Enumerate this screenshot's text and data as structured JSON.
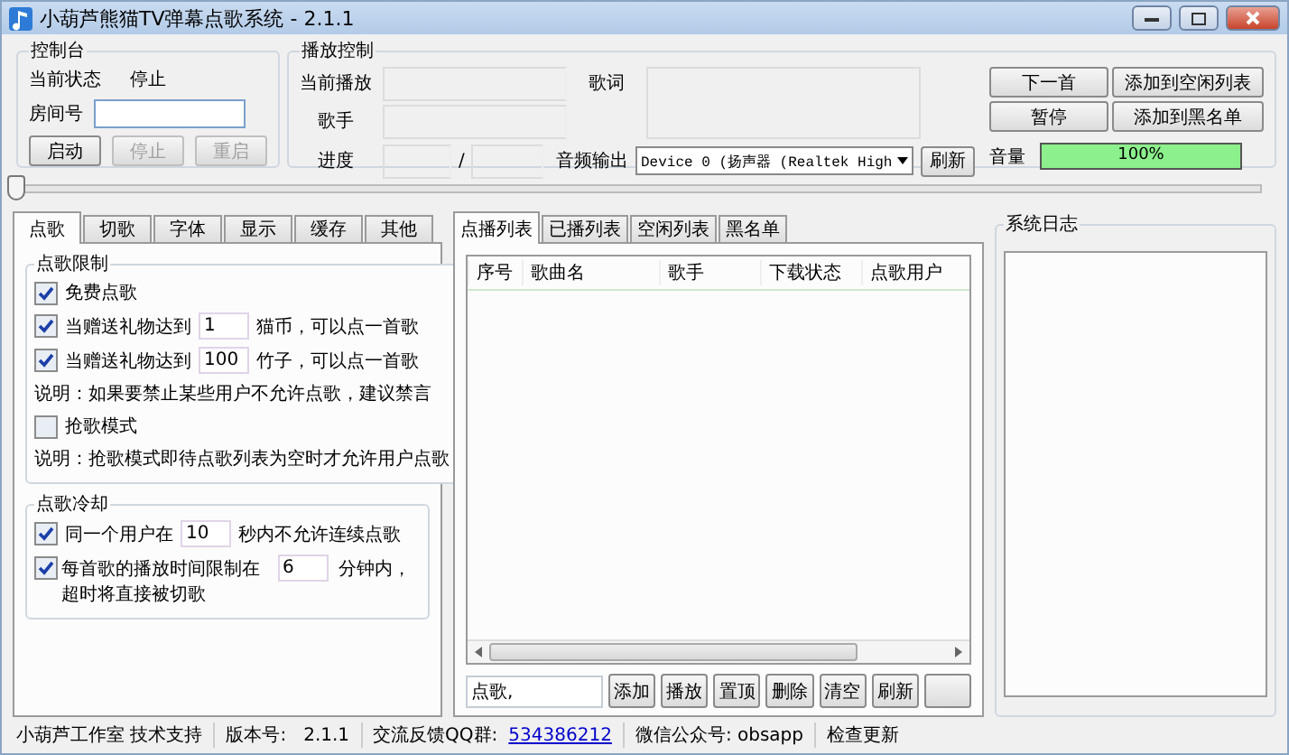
{
  "window": {
    "title": "小葫芦熊猫TV弹幕点歌系统 - 2.1.1"
  },
  "console": {
    "title": "控制台",
    "status_label": "当前状态",
    "status_value": "停止",
    "room_label": "房间号",
    "buttons": [
      {
        "label": "启动",
        "disabled": false
      },
      {
        "label": "停止",
        "disabled": true
      },
      {
        "label": "重启",
        "disabled": true
      }
    ]
  },
  "playback": {
    "title": "播放控制",
    "now_label": "当前播放",
    "singer_label": "歌手",
    "progress_label": "进度",
    "separator": "/",
    "lyrics_label": "歌词",
    "audio_label": "音频输出",
    "audio_device": "Device 0 (扬声器 (Realtek High",
    "refresh": "刷新",
    "buttons": [
      "下一首",
      "添加到空闲列表",
      "暂停",
      "添加到黑名单"
    ],
    "volume_label": "音量",
    "volume": {
      "level": 1,
      "reading": "100%"
    }
  },
  "seek": {
    "level": 0
  },
  "settings_tabs": [
    {
      "label": "点歌",
      "selected": true
    },
    {
      "label": "切歌",
      "selected": false
    },
    {
      "label": "字体",
      "selected": false
    },
    {
      "label": "显示",
      "selected": false
    },
    {
      "label": "缓存",
      "selected": false
    },
    {
      "label": "其他",
      "selected": false
    }
  ],
  "groups": [
    {
      "title": "点歌限制",
      "items": [
        {
          "kind": "check",
          "label": "免费点歌",
          "checked": true
        },
        {
          "kind": "field",
          "label": "当赠送礼物达到",
          "checked": true,
          "value": "1",
          "suffix": "猫币，可以点一首歌"
        },
        {
          "kind": "field",
          "label": "当赠送礼物达到",
          "checked": true,
          "value": "100",
          "suffix": "竹子，可以点一首歌"
        },
        {
          "kind": "note",
          "text": "说明：如果要禁止某些用户不允许点歌，建议禁言"
        },
        {
          "kind": "check",
          "label": "抢歌模式",
          "checked": false
        },
        {
          "kind": "note",
          "text": "说明：抢歌模式即待点歌列表为空时才允许用户点歌"
        }
      ]
    },
    {
      "title": "点歌冷却",
      "items": [
        {
          "kind": "field",
          "label": "同一个用户在",
          "checked": true,
          "value": "10",
          "suffix": "秒内不允许连续点歌"
        },
        {
          "kind": "wrap",
          "label": "每首歌的播放时间限制在",
          "checked": true,
          "value": "6",
          "suffix": "分钟内，",
          "second_line": "超时将直接被切歌"
        }
      ]
    }
  ],
  "list_tabs": [
    {
      "label": "点播列表",
      "selected": true
    },
    {
      "label": "已播列表",
      "selected": false
    },
    {
      "label": "空闲列表",
      "selected": false
    },
    {
      "label": "黑名单",
      "selected": false
    }
  ],
  "table": {
    "columns": [
      "序号",
      "歌曲名",
      "歌手",
      "下载状态",
      "点歌用户"
    ]
  },
  "request_field": {
    "value": "点歌,"
  },
  "actions": [
    "添加",
    "播放",
    "置顶",
    "删除",
    "清空",
    "刷新"
  ],
  "log": {
    "title": "系统日志"
  },
  "status_bar": [
    {
      "kind": "text",
      "text": "小葫芦工作室 技术支持"
    },
    {
      "kind": "text",
      "text": "版本号:   2.1.1"
    },
    {
      "kind": "label",
      "text": "交流反馈QQ群:",
      "link": "534386212"
    },
    {
      "kind": "text",
      "text": "微信公众号: obsapp"
    },
    {
      "kind": "text",
      "text": "检查更新"
    }
  ]
}
